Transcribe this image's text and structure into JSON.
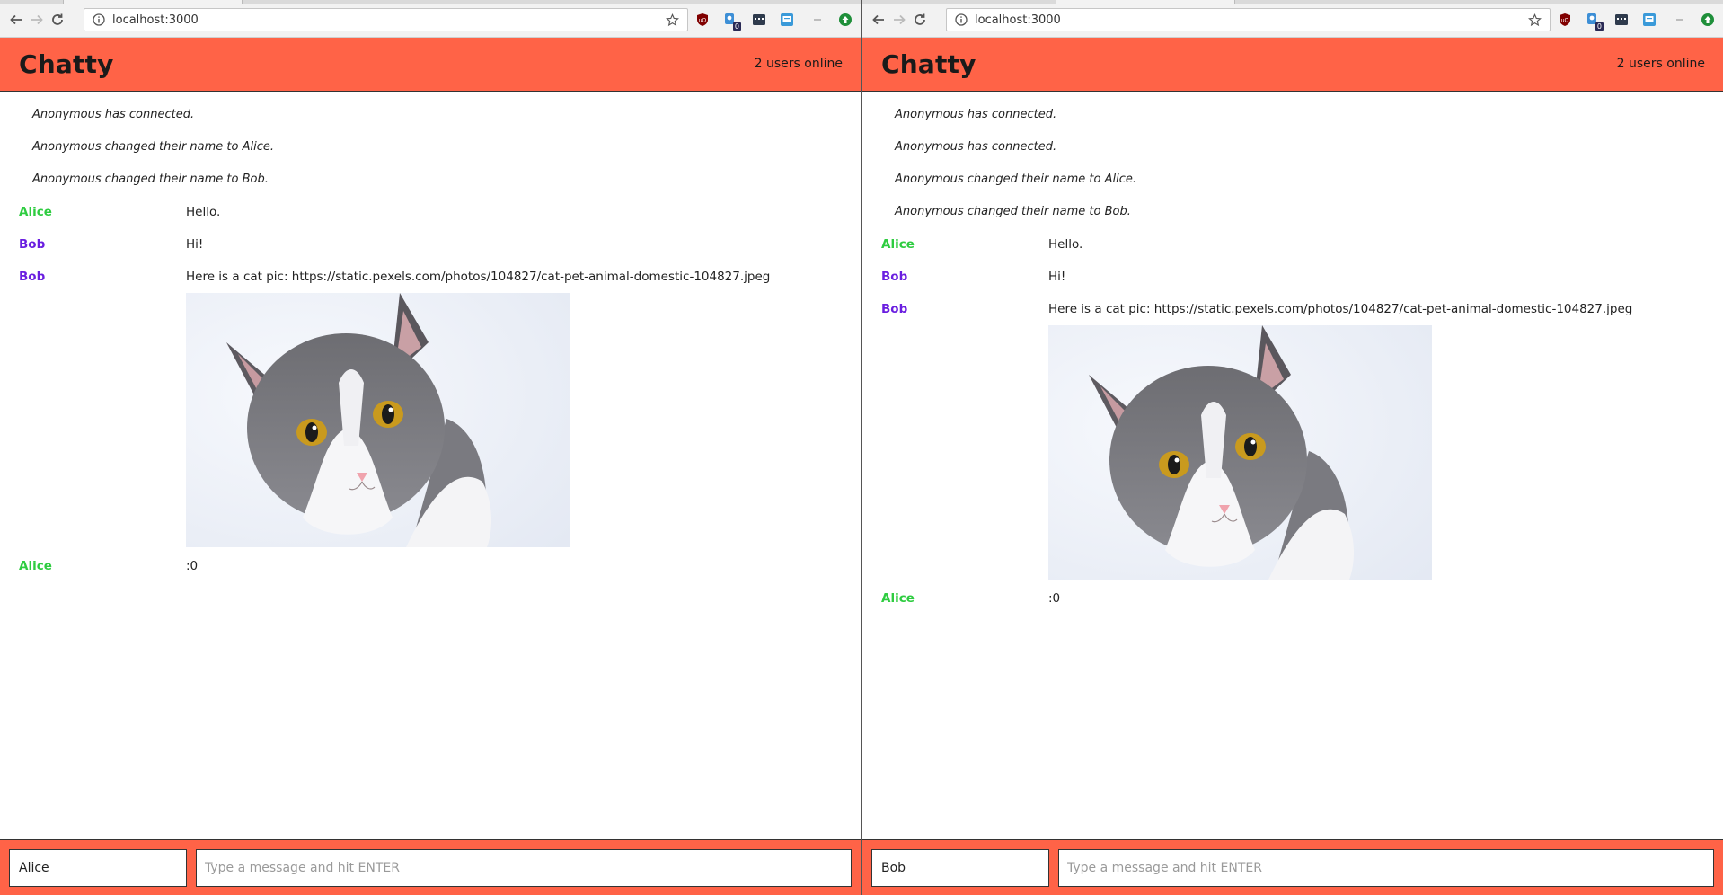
{
  "browser": {
    "url": "localhost:3000"
  },
  "app": {
    "title": "Chatty",
    "users_online": "2 users online",
    "placeholder": "Type a message and hit ENTER",
    "colors": {
      "header": "#ff6347",
      "alice": "#2ecc40",
      "bob": "#6a1ee0"
    }
  },
  "left": {
    "name_value": "Alice",
    "system_messages": [
      "Anonymous has connected.",
      "Anonymous changed their name to Alice.",
      "Anonymous changed their name to Bob."
    ],
    "messages": [
      {
        "user": "Alice",
        "text": "Hello."
      },
      {
        "user": "Bob",
        "text": "Hi!"
      },
      {
        "user": "Bob",
        "text": "Here is a cat pic: https://static.pexels.com/photos/104827/cat-pet-animal-domestic-104827.jpeg"
      },
      {
        "user": "Alice",
        "text": ":0"
      }
    ]
  },
  "right": {
    "name_value": "Bob",
    "system_messages": [
      "Anonymous has connected.",
      "Anonymous has connected.",
      "Anonymous changed their name to Alice.",
      "Anonymous changed their name to Bob."
    ],
    "messages": [
      {
        "user": "Alice",
        "text": "Hello."
      },
      {
        "user": "Bob",
        "text": "Hi!"
      },
      {
        "user": "Bob",
        "text": "Here is a cat pic: https://static.pexels.com/photos/104827/cat-pet-animal-domestic-104827.jpeg"
      },
      {
        "user": "Alice",
        "text": ":0"
      }
    ]
  }
}
